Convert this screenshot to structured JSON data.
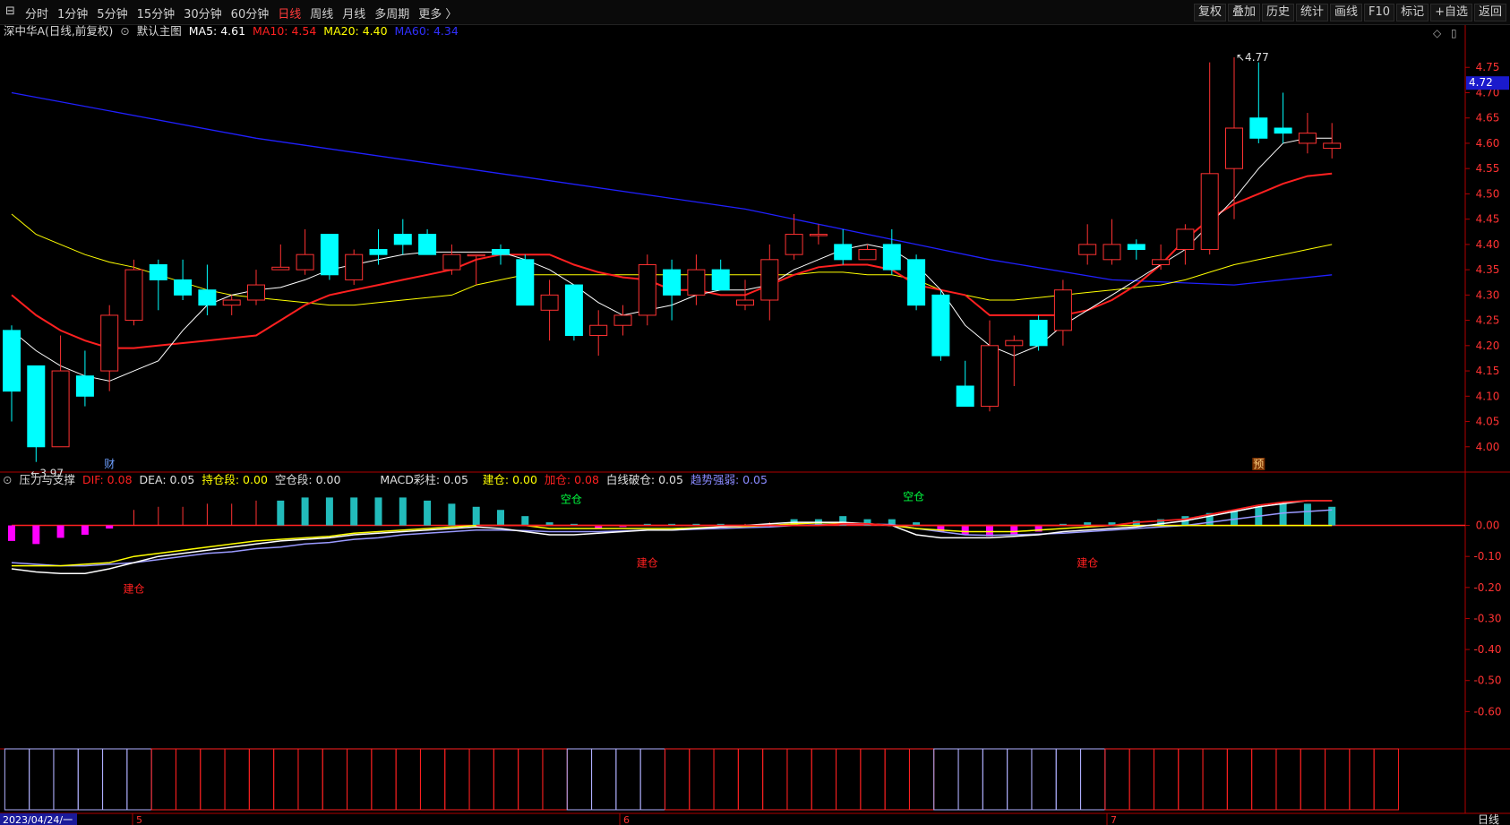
{
  "toolbar": {
    "periods": [
      "分时",
      "1分钟",
      "5分钟",
      "15分钟",
      "30分钟",
      "60分钟",
      "日线",
      "周线",
      "月线",
      "多周期",
      "更多 〉"
    ],
    "active_period": "日线",
    "right_buttons": [
      "复权",
      "叠加",
      "历史",
      "统计",
      "画线",
      "F10",
      "标记",
      "+自选",
      "返回"
    ]
  },
  "main_legend": {
    "title": "深中华A(日线,前复权)",
    "indicator": "默认主图",
    "ma5_label": "MA5: 4.61",
    "ma10_label": "MA10: 4.54",
    "ma20_label": "MA20: 4.40",
    "ma60_label": "MA60: 4.34"
  },
  "sub_legend": {
    "title": "压力与支撑",
    "dif": "DIF: 0.08",
    "dea": "DEA: 0.05",
    "hold": "持仓段: 0.00",
    "empty": "空仓段: 0.00",
    "macd": "MACD彩柱: 0.05",
    "build": "建仓: 0.00",
    "add": "加仓: 0.08",
    "white_break": "白线破仓: 0.05",
    "trend": "趋势强弱: 0.05"
  },
  "annotations": {
    "high_label": "4.77",
    "low_label": "3.97",
    "cai_marker": "财",
    "yu_marker": "预",
    "build_labels": [
      "建仓",
      "建仓",
      "建仓"
    ],
    "empty_labels": [
      "空仓",
      "空仓"
    ]
  },
  "price_tag": "4.72",
  "axis": {
    "date_label": "2023/04/24/一",
    "month_labels": [
      "5",
      "6",
      "7"
    ],
    "period_label": "日线"
  },
  "colors": {
    "up": "#ff3232",
    "down": "#00ffff",
    "ma5": "#ffffff",
    "ma10": "#ff2020",
    "ma20": "#ffff00",
    "ma60": "#2020ff",
    "axis": "#b00000",
    "pink": "#ff00ff"
  },
  "chart_data": {
    "type": "candlestick",
    "title": "深中华A(日线,前复权)",
    "ylim": [
      3.95,
      4.8
    ],
    "y_ticks": [
      "4.75",
      "4.70",
      "4.65",
      "4.60",
      "4.55",
      "4.50",
      "4.45",
      "4.40",
      "4.35",
      "4.30",
      "4.25",
      "4.20",
      "4.15",
      "4.10",
      "4.05",
      "4.00"
    ],
    "candles": [
      [
        4.23,
        4.24,
        4.05,
        4.11
      ],
      [
        4.16,
        4.16,
        3.97,
        4.0
      ],
      [
        4.0,
        4.22,
        4.0,
        4.15
      ],
      [
        4.14,
        4.19,
        4.08,
        4.1
      ],
      [
        4.15,
        4.28,
        4.11,
        4.26
      ],
      [
        4.25,
        4.37,
        4.24,
        4.35
      ],
      [
        4.36,
        4.37,
        4.27,
        4.33
      ],
      [
        4.33,
        4.37,
        4.29,
        4.3
      ],
      [
        4.31,
        4.36,
        4.26,
        4.28
      ],
      [
        4.28,
        4.3,
        4.26,
        4.29
      ],
      [
        4.29,
        4.35,
        4.28,
        4.32
      ],
      [
        4.35,
        4.4,
        4.35,
        4.355
      ],
      [
        4.35,
        4.43,
        4.34,
        4.38
      ],
      [
        4.42,
        4.42,
        4.33,
        4.34
      ],
      [
        4.33,
        4.39,
        4.32,
        4.38
      ],
      [
        4.39,
        4.43,
        4.36,
        4.38
      ],
      [
        4.42,
        4.45,
        4.38,
        4.4
      ],
      [
        4.42,
        4.43,
        4.38,
        4.38
      ],
      [
        4.35,
        4.4,
        4.34,
        4.38
      ],
      [
        4.38,
        4.38,
        4.32,
        4.38
      ],
      [
        4.39,
        4.4,
        4.36,
        4.38
      ],
      [
        4.37,
        4.38,
        4.3,
        4.28
      ],
      [
        4.27,
        4.33,
        4.21,
        4.3
      ],
      [
        4.32,
        4.32,
        4.21,
        4.22
      ],
      [
        4.22,
        4.27,
        4.18,
        4.24
      ],
      [
        4.24,
        4.28,
        4.22,
        4.26
      ],
      [
        4.26,
        4.38,
        4.24,
        4.36
      ],
      [
        4.35,
        4.37,
        4.25,
        4.3
      ],
      [
        4.3,
        4.38,
        4.28,
        4.35
      ],
      [
        4.35,
        4.37,
        4.31,
        4.31
      ],
      [
        4.28,
        4.33,
        4.27,
        4.29
      ],
      [
        4.29,
        4.4,
        4.25,
        4.37
      ],
      [
        4.38,
        4.46,
        4.37,
        4.42
      ],
      [
        4.42,
        4.44,
        4.4,
        4.42
      ],
      [
        4.4,
        4.43,
        4.36,
        4.37
      ],
      [
        4.37,
        4.4,
        4.37,
        4.39
      ],
      [
        4.4,
        4.43,
        4.34,
        4.35
      ],
      [
        4.37,
        4.38,
        4.27,
        4.28
      ],
      [
        4.3,
        4.31,
        4.17,
        4.18
      ],
      [
        4.12,
        4.17,
        4.08,
        4.08
      ],
      [
        4.08,
        4.25,
        4.07,
        4.2
      ],
      [
        4.2,
        4.22,
        4.12,
        4.21
      ],
      [
        4.25,
        4.26,
        4.19,
        4.2
      ],
      [
        4.23,
        4.33,
        4.2,
        4.31
      ],
      [
        4.38,
        4.44,
        4.36,
        4.4
      ],
      [
        4.37,
        4.45,
        4.36,
        4.4
      ],
      [
        4.4,
        4.41,
        4.37,
        4.39
      ],
      [
        4.36,
        4.4,
        4.35,
        4.37
      ],
      [
        4.39,
        4.44,
        4.36,
        4.43
      ],
      [
        4.39,
        4.76,
        4.38,
        4.54
      ],
      [
        4.55,
        4.77,
        4.45,
        4.63
      ],
      [
        4.65,
        4.76,
        4.6,
        4.61
      ],
      [
        4.63,
        4.7,
        4.6,
        4.62
      ],
      [
        4.6,
        4.66,
        4.58,
        4.62
      ],
      [
        4.59,
        4.64,
        4.57,
        4.6
      ]
    ],
    "ma5": [
      4.23,
      4.19,
      4.16,
      4.14,
      4.13,
      4.15,
      4.17,
      4.23,
      4.28,
      4.3,
      4.31,
      4.315,
      4.33,
      4.35,
      4.36,
      4.37,
      4.38,
      4.385,
      4.385,
      4.385,
      4.385,
      4.37,
      4.35,
      4.32,
      4.285,
      4.26,
      4.27,
      4.28,
      4.3,
      4.31,
      4.31,
      4.32,
      4.35,
      4.37,
      4.39,
      4.4,
      4.39,
      4.36,
      4.31,
      4.24,
      4.2,
      4.18,
      4.2,
      4.24,
      4.27,
      4.3,
      4.33,
      4.36,
      4.39,
      4.44,
      4.49,
      4.55,
      4.6,
      4.61,
      4.61
    ],
    "ma10": [
      4.3,
      4.26,
      4.23,
      4.21,
      4.195,
      4.195,
      4.2,
      4.205,
      4.21,
      4.215,
      4.22,
      4.25,
      4.28,
      4.3,
      4.31,
      4.32,
      4.33,
      4.34,
      4.35,
      4.37,
      4.38,
      4.38,
      4.38,
      4.36,
      4.345,
      4.335,
      4.33,
      4.31,
      4.31,
      4.3,
      4.3,
      4.32,
      4.34,
      4.355,
      4.36,
      4.36,
      4.35,
      4.32,
      4.31,
      4.3,
      4.26,
      4.26,
      4.26,
      4.26,
      4.27,
      4.29,
      4.32,
      4.36,
      4.41,
      4.45,
      4.48,
      4.5,
      4.52,
      4.535,
      4.54
    ],
    "ma20": [
      4.46,
      4.42,
      4.4,
      4.38,
      4.365,
      4.355,
      4.34,
      4.325,
      4.31,
      4.3,
      4.295,
      4.29,
      4.285,
      4.28,
      4.28,
      4.285,
      4.29,
      4.295,
      4.3,
      4.32,
      4.33,
      4.34,
      4.34,
      4.34,
      4.34,
      4.34,
      4.34,
      4.34,
      4.34,
      4.34,
      4.34,
      4.34,
      4.34,
      4.345,
      4.345,
      4.34,
      4.34,
      4.33,
      4.31,
      4.3,
      4.29,
      4.29,
      4.295,
      4.3,
      4.305,
      4.31,
      4.315,
      4.32,
      4.33,
      4.345,
      4.36,
      4.37,
      4.38,
      4.39,
      4.4
    ],
    "ma60_points": [
      [
        0,
        4.7
      ],
      [
        10,
        4.61
      ],
      [
        20,
        4.54
      ],
      [
        30,
        4.47
      ],
      [
        36,
        4.41
      ],
      [
        40,
        4.37
      ],
      [
        45,
        4.33
      ],
      [
        50,
        4.32
      ],
      [
        54,
        4.34
      ]
    ],
    "macd_hist": [
      -0.05,
      -0.06,
      -0.04,
      -0.03,
      -0.01,
      0.05,
      0.06,
      0.06,
      0.07,
      0.07,
      0.08,
      0.08,
      0.09,
      0.09,
      0.09,
      0.09,
      0.09,
      0.08,
      0.07,
      0.06,
      0.05,
      0.03,
      0.01,
      0.005,
      -0.01,
      -0.005,
      0.005,
      0.005,
      0.005,
      0.005,
      0.005,
      0.01,
      0.02,
      0.02,
      0.03,
      0.02,
      0.02,
      0.01,
      -0.02,
      -0.03,
      -0.035,
      -0.03,
      -0.02,
      0.005,
      0.01,
      0.01,
      0.015,
      0.02,
      0.03,
      0.04,
      0.05,
      0.06,
      0.07,
      0.07,
      0.06
    ],
    "dif": [
      -0.14,
      -0.15,
      -0.155,
      -0.155,
      -0.14,
      -0.12,
      -0.1,
      -0.09,
      -0.08,
      -0.07,
      -0.06,
      -0.05,
      -0.045,
      -0.04,
      -0.03,
      -0.025,
      -0.02,
      -0.015,
      -0.01,
      -0.005,
      -0.01,
      -0.02,
      -0.03,
      -0.03,
      -0.025,
      -0.02,
      -0.015,
      -0.015,
      -0.01,
      -0.005,
      0.0,
      0.005,
      0.01,
      0.01,
      0.01,
      0.005,
      0.0,
      -0.03,
      -0.04,
      -0.04,
      -0.04,
      -0.035,
      -0.03,
      -0.02,
      -0.015,
      -0.01,
      -0.005,
      0.005,
      0.015,
      0.03,
      0.045,
      0.06,
      0.07,
      0.08,
      0.08
    ],
    "dea": [
      -0.12,
      -0.125,
      -0.13,
      -0.13,
      -0.125,
      -0.12,
      -0.11,
      -0.1,
      -0.09,
      -0.085,
      -0.075,
      -0.07,
      -0.06,
      -0.055,
      -0.045,
      -0.04,
      -0.03,
      -0.025,
      -0.02,
      -0.015,
      -0.015,
      -0.017,
      -0.02,
      -0.02,
      -0.02,
      -0.018,
      -0.015,
      -0.015,
      -0.012,
      -0.01,
      -0.007,
      -0.005,
      0.0,
      0.002,
      0.004,
      0.004,
      0.003,
      -0.01,
      -0.02,
      -0.03,
      -0.032,
      -0.03,
      -0.028,
      -0.025,
      -0.02,
      -0.015,
      -0.01,
      -0.005,
      0.0,
      0.01,
      0.02,
      0.03,
      0.04,
      0.045,
      0.05
    ],
    "yellow": [
      -0.13,
      -0.13,
      -0.13,
      -0.125,
      -0.12,
      -0.1,
      -0.09,
      -0.08,
      -0.07,
      -0.06,
      -0.05,
      -0.045,
      -0.04,
      -0.035,
      -0.025,
      -0.02,
      -0.015,
      -0.01,
      -0.005,
      0.0,
      0.0,
      0.0,
      -0.01,
      -0.01,
      -0.01,
      -0.01,
      -0.01,
      -0.01,
      -0.008,
      -0.005,
      -0.003,
      0.0,
      0.005,
      0.008,
      0.008,
      0.005,
      0.0,
      -0.01,
      -0.015,
      -0.02,
      -0.02,
      -0.02,
      -0.015,
      -0.01,
      -0.005,
      0.0,
      0.0,
      0.0,
      0.0,
      0.0,
      0.0,
      0.0,
      0.0,
      0.0,
      0.0
    ],
    "redline": [
      null,
      null,
      null,
      null,
      null,
      null,
      null,
      null,
      null,
      null,
      null,
      null,
      null,
      null,
      null,
      null,
      null,
      null,
      null,
      0.0,
      0.0,
      0.0,
      0.0,
      0.0,
      0.0,
      0.0,
      0.0,
      0.0,
      0.0,
      0.0,
      0.0,
      0.0,
      0.0,
      0.0,
      0.005,
      0.005,
      0.0,
      0.0,
      0.0,
      0.0,
      0.0,
      0.0,
      0.0,
      0.0,
      0.0,
      0.0,
      0.01,
      0.015,
      0.02,
      0.035,
      0.05,
      0.065,
      0.075,
      0.08,
      0.08
    ],
    "sub_ylim": [
      -0.7,
      0.12
    ],
    "sub_y_ticks": [
      "0.00",
      "-0.10",
      "-0.20",
      "-0.30",
      "-0.40",
      "-0.50",
      "-0.60"
    ],
    "segments": [
      {
        "from": 0,
        "to": 5,
        "kind": "empty"
      },
      {
        "from": 6,
        "to": 22,
        "kind": "hold"
      },
      {
        "from": 23,
        "to": 26,
        "kind": "empty"
      },
      {
        "from": 27,
        "to": 37,
        "kind": "hold"
      },
      {
        "from": 38,
        "to": 44,
        "kind": "empty"
      },
      {
        "from": 45,
        "to": 56,
        "kind": "hold"
      }
    ]
  }
}
